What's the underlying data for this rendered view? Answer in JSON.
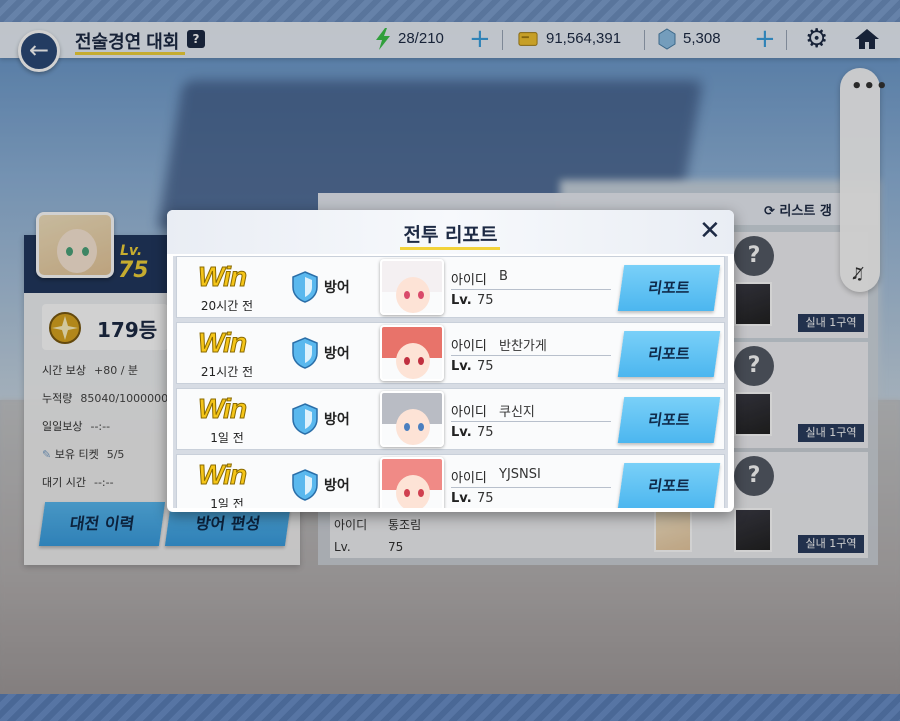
{
  "header": {
    "title": "전술경연 대회",
    "help": "?",
    "stamina": "28/210",
    "credits": "91,564,391",
    "gems": "5,308"
  },
  "player": {
    "lv_label": "Lv.",
    "level": "75",
    "rank": "179등",
    "stats": [
      {
        "label": "시간 보상",
        "value": "+80 / 분"
      },
      {
        "label": "누적량",
        "value": "85040/1000000"
      },
      {
        "label": "일일보상",
        "value": "--:--"
      },
      {
        "label": "보유 티켓",
        "value": "5/5"
      },
      {
        "label": "대기 시간",
        "value": "--:--"
      }
    ],
    "history_button": "대전 이력",
    "defense_button": "방어 편성"
  },
  "opponents": {
    "refresh_label": "리스트 갱",
    "zone": "실내 1구역",
    "visible_id_label": "아이디",
    "visible_id_value": "통조림",
    "visible_lv_label": "Lv.",
    "visible_lv_value": "75"
  },
  "modal": {
    "title": "전투 리포트",
    "close": "✕",
    "reports": [
      {
        "result": "Win",
        "time": "20시간 전",
        "mode": "방어",
        "id_label": "아이디",
        "id": "B",
        "lv_label": "Lv.",
        "lv": "75",
        "button": "리포트",
        "hair": "#f4f0f2",
        "eye": "#d94a6a"
      },
      {
        "result": "Win",
        "time": "21시간 전",
        "mode": "방어",
        "id_label": "아이디",
        "id": "반찬가게",
        "lv_label": "Lv.",
        "lv": "75",
        "button": "리포트",
        "hair": "#e8736a",
        "eye": "#c03040"
      },
      {
        "result": "Win",
        "time": "1일 전",
        "mode": "방어",
        "id_label": "아이디",
        "id": "쿠신지",
        "lv_label": "Lv.",
        "lv": "75",
        "button": "리포트",
        "hair": "#b9bcc4",
        "eye": "#4a7fc0"
      },
      {
        "result": "Win",
        "time": "1일 전",
        "mode": "방어",
        "id_label": "아이디",
        "id": "YJSNSI",
        "lv_label": "Lv.",
        "lv": "75",
        "button": "리포트",
        "hair": "#f08a86",
        "eye": "#d04050"
      }
    ]
  },
  "colors": {
    "accent": "#4cb6ef",
    "navy": "#1d2a44",
    "win": "#f5c518",
    "highlight": "#f2d23a"
  }
}
